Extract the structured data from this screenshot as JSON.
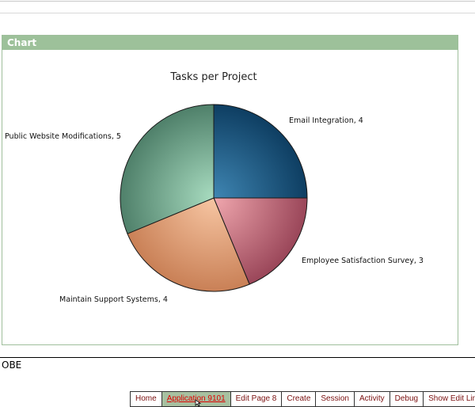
{
  "region": {
    "title": "Chart"
  },
  "chart_data": {
    "type": "pie",
    "title": "Tasks per Project",
    "slices": [
      {
        "label": "Email Integration",
        "value": 4,
        "color": "#1f5a83"
      },
      {
        "label": "Employee Satisfaction Survey",
        "value": 3,
        "color": "#b65d71"
      },
      {
        "label": "Maintain Support Systems",
        "value": 4,
        "color": "#e09a6e"
      },
      {
        "label": "Public Website Modifications",
        "value": 5,
        "color": "#6e9e83"
      }
    ],
    "labels": [
      "Email Integration, 4",
      "Employee Satisfaction Survey, 3",
      "Maintain Support Systems, 4",
      "Public Website Modifications, 5"
    ]
  },
  "footer": {
    "text": "OBE"
  },
  "devbar": {
    "items": [
      "Home",
      "Application 9101",
      "Edit Page 8",
      "Create",
      "Session",
      "Activity",
      "Debug",
      "Show Edit Links"
    ],
    "active_index": 1
  }
}
